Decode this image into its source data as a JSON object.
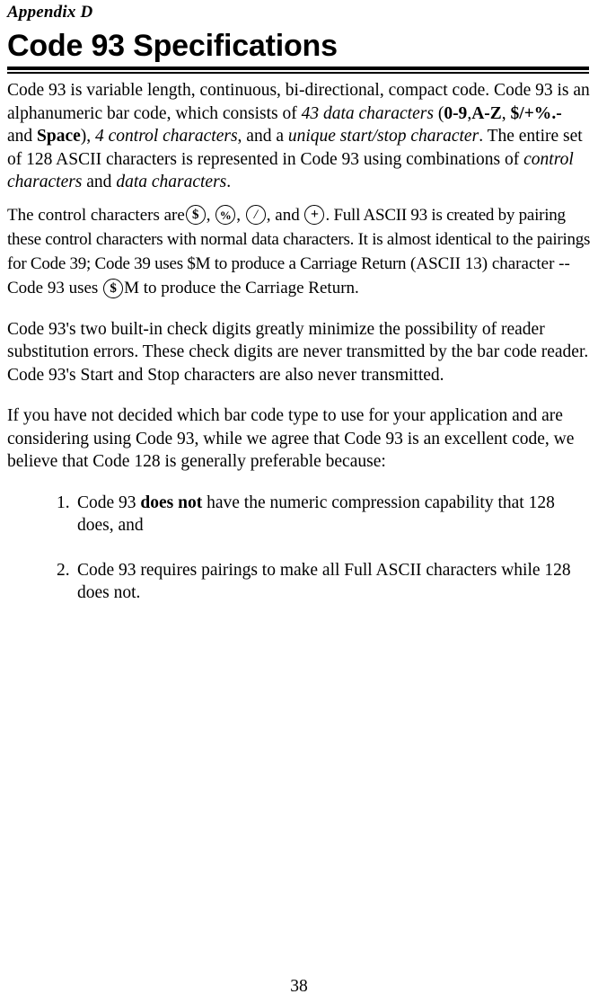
{
  "document": {
    "appendix_label": "Appendix D",
    "title": "Code 93 Specifications",
    "page_number": "38"
  },
  "paragraphs": {
    "intro": {
      "s1": "Code 93 is variable length, continuous, bi-directional, compact code.  Code 93 is an alphanumeric bar code, which consists of ",
      "em_43_data_characters": "43 data characters",
      "s2": " (",
      "b_0_9": "0-9",
      "s3": ",",
      "b_a_z": "A-Z",
      "s4": ", ",
      "b_symbols": "$/+%",
      "b_symbols_dot": ".",
      "b_symbols_dash": "-",
      "s5": " and ",
      "b_space": "Space",
      "s6": "), ",
      "em_4_control_characters": "4 control characters",
      "s7": ", and a ",
      "em_unique_startstop": "unique start/stop character",
      "s8": ". The entire set of 128 ASCII characters is represented in Code 93 using combinations of ",
      "em_control_characters": "control characters",
      "s9": " and ",
      "em_data_characters": "data characters",
      "s10": "."
    },
    "control_chars": {
      "lead": "The control characters are",
      "comma1": ",",
      "comma2": ",",
      "and": ", and",
      "tail": ".  Full ASCII 93 is created by pairing these control characters with normal data characters.  It is almost identical to the pairings for Code 39; Code 39 uses $M to produce a Carriage Return",
      "line3_lead": "(ASCII 13) character -- Code 93 uses",
      "line3_tail": "M to produce the Carriage Return.",
      "glyphs": {
        "dollar": "$",
        "percent": "%",
        "slash": "/",
        "plus": "+"
      }
    },
    "check_digits": "Code 93's two built-in check digits greatly minimize the possibility of reader substitution errors. These check digits are never transmitted by the bar code reader.  Code 93's Start and Stop characters are also never transmitted.",
    "recommendation": "If you have not decided which bar code type to use for your application and are considering using Code 93, while we agree that Code 93 is an excellent code, we believe that Code 128 is generally preferable because:"
  },
  "list": {
    "items": [
      {
        "marker": "1.",
        "text_before": "Code 93 ",
        "bold": "does not",
        "text_after": " have the numeric compression capability that 128 does, and"
      },
      {
        "marker": "2.",
        "text_before": "Code 93 requires pairings to make all Full ASCII characters while 128 does not.",
        "bold": "",
        "text_after": ""
      }
    ]
  },
  "colors": {
    "text": "#000000",
    "background": "#ffffff",
    "rule": "#000000"
  }
}
